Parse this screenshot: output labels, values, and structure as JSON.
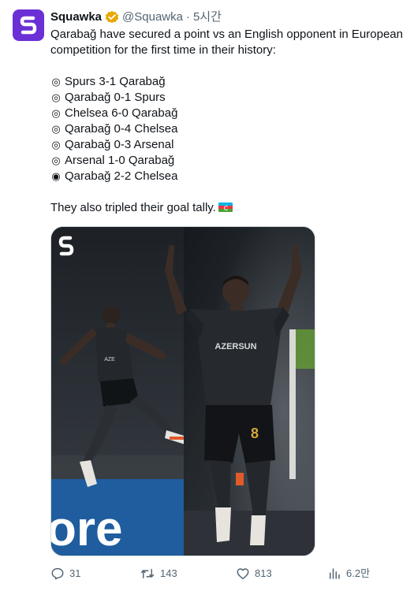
{
  "author": {
    "name": "Squawka",
    "handle": "@Squawka",
    "separator": "·",
    "time": "5시간"
  },
  "tweet": {
    "intro": "Qarabağ have secured a point vs an English opponent in European competition for the first time in their history:",
    "results": [
      {
        "icon": "double-circle-icon",
        "text": "Spurs 3-1 Qarabağ"
      },
      {
        "icon": "double-circle-icon",
        "text": "Qarabağ 0-1 Spurs"
      },
      {
        "icon": "double-circle-icon",
        "text": "Chelsea 6-0 Qarabağ"
      },
      {
        "icon": "double-circle-icon",
        "text": "Qarabağ 0-4 Chelsea"
      },
      {
        "icon": "double-circle-icon",
        "text": "Qarabağ 0-3 Arsenal"
      },
      {
        "icon": "double-circle-icon",
        "text": "Arsenal 1-0 Qarabağ"
      },
      {
        "icon": "filled-circle-icon",
        "text": "Qarabağ 2-2 Chelsea"
      }
    ],
    "closing": "They also tripled their goal tally.",
    "closing_emoji": "azerbaijan-flag-icon"
  },
  "media": {
    "shirt_text": "AZERSUN",
    "number": "8",
    "board_text": "ore"
  },
  "actions": {
    "replies": "31",
    "reposts": "143",
    "likes": "813",
    "views": "6.2만"
  },
  "colors": {
    "brand": "#6b2fd6",
    "verified": "#e8a800",
    "secondary_text": "#536471"
  }
}
